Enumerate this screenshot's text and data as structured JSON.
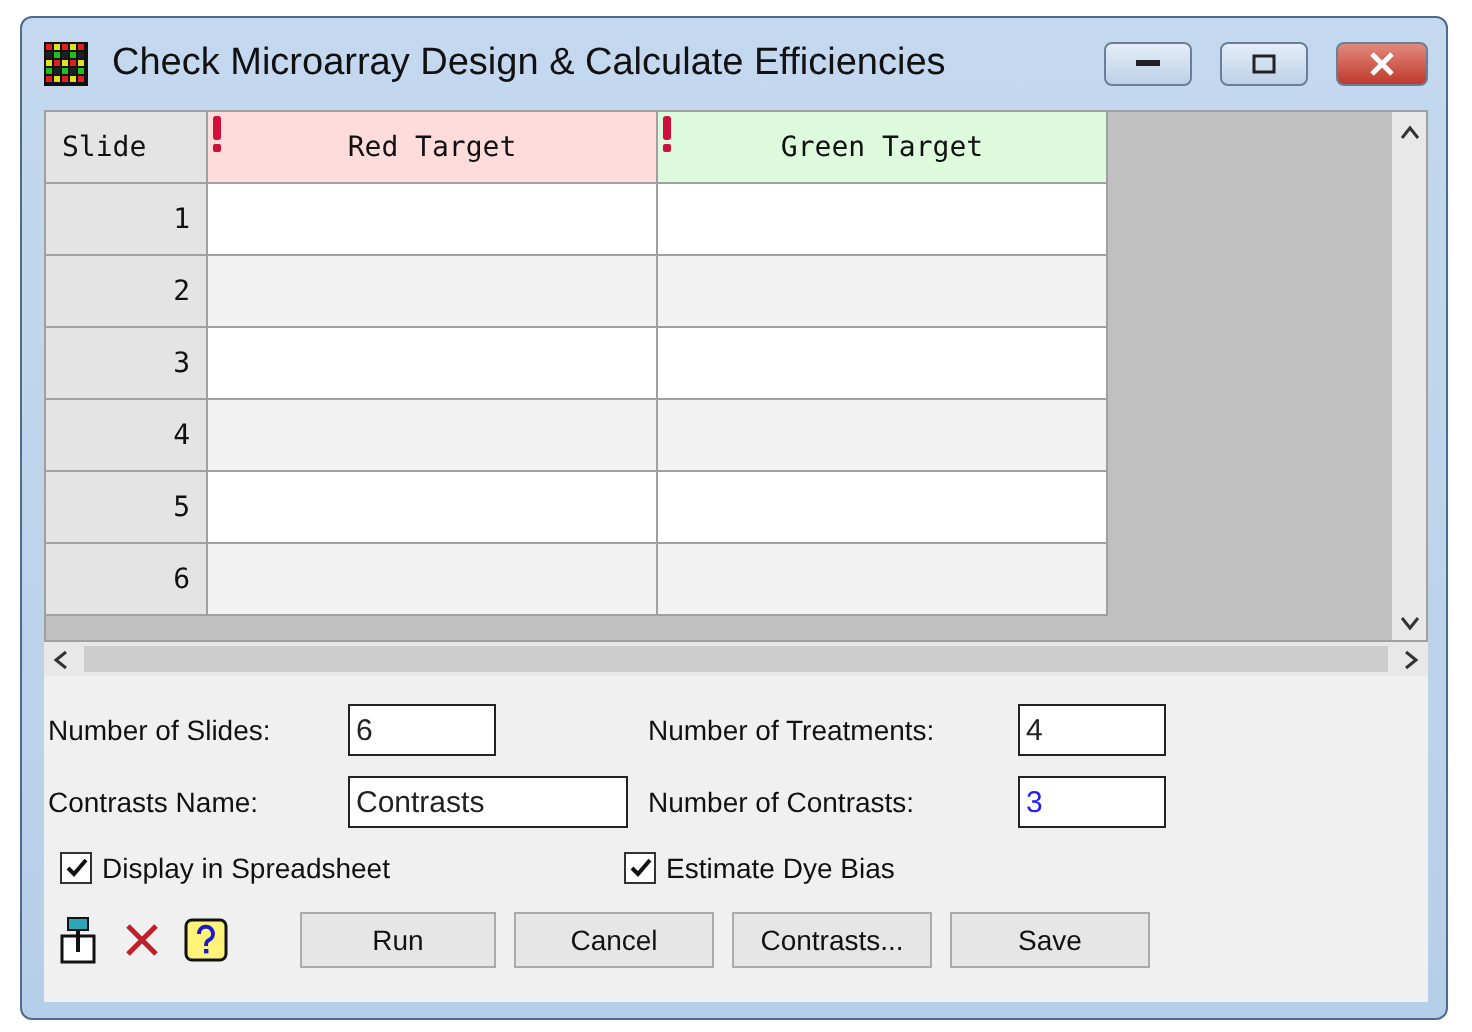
{
  "window": {
    "title": "Check Microarray Design & Calculate Efficiencies"
  },
  "grid": {
    "columns": [
      {
        "label": "Slide",
        "kind": "index"
      },
      {
        "label": "Red Target",
        "kind": "target",
        "color": "#ffdcdc"
      },
      {
        "label": "Green Target",
        "kind": "target",
        "color": "#ddfadd"
      }
    ],
    "rows": [
      {
        "label": "1"
      },
      {
        "label": "2"
      },
      {
        "label": "3"
      },
      {
        "label": "4"
      },
      {
        "label": "5"
      },
      {
        "label": "6"
      }
    ]
  },
  "fields": [
    {
      "label": "Number of Slides:",
      "value": "6",
      "wide": false
    },
    {
      "label": "Number of Treatments:",
      "value": "4",
      "wide": false
    },
    {
      "label": "Contrasts Name:",
      "value": "Contrasts",
      "wide": true
    },
    {
      "label": "Number of Contrasts:",
      "value": "3",
      "wide": false,
      "focused": true
    }
  ],
  "checkboxes": [
    {
      "label": "Display in Spreadsheet",
      "checked": true
    },
    {
      "label": "Estimate Dye Bias",
      "checked": true
    }
  ],
  "buttons": [
    "Run",
    "Cancel",
    "Contrasts...",
    "Save"
  ]
}
